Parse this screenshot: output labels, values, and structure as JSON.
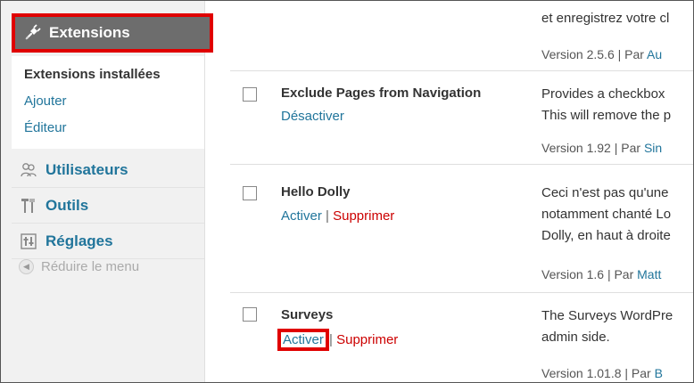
{
  "sidebar": {
    "section_title": "Extensions",
    "submenu": {
      "current": "Extensions installées",
      "add": "Ajouter",
      "editor": "Éditeur"
    },
    "items": [
      {
        "label": "Utilisateurs",
        "icon": "users-icon"
      },
      {
        "label": "Outils",
        "icon": "tools-icon"
      },
      {
        "label": "Réglages",
        "icon": "settings-icon"
      }
    ],
    "collapse_label": "Réduire le menu"
  },
  "plugins": [
    {
      "name": "",
      "desc_lines": [
        "et enregistrez votre cl"
      ],
      "version_prefix": "Version 2.5.6 | Par ",
      "author": "Au"
    },
    {
      "name": "Exclude Pages from Navigation",
      "actions": {
        "deactivate": "Désactiver"
      },
      "desc_lines": [
        "Provides a checkbox",
        "This will remove the p"
      ],
      "version_prefix": "Version 1.92 | Par ",
      "author": "Sin"
    },
    {
      "name": "Hello Dolly",
      "actions": {
        "activate": "Activer",
        "separator": "|",
        "delete": "Supprimer"
      },
      "desc_lines": [
        "Ceci n'est pas qu'une",
        "notamment chanté Lo",
        "Dolly, en haut à droite"
      ],
      "version_prefix": "Version 1.6 | Par ",
      "author": "Matt"
    },
    {
      "name": "Surveys",
      "actions": {
        "activate": "Activer",
        "separator": "|",
        "delete": "Supprimer"
      },
      "desc_lines": [
        "The Surveys WordPre",
        "admin side."
      ],
      "version_prefix": "Version 1.01.8 | Par ",
      "author": "B"
    }
  ],
  "colors": {
    "link": "#21759b",
    "delete": "#cc0000",
    "highlight": "#e00000",
    "menu_head": "#6d6d6d"
  }
}
